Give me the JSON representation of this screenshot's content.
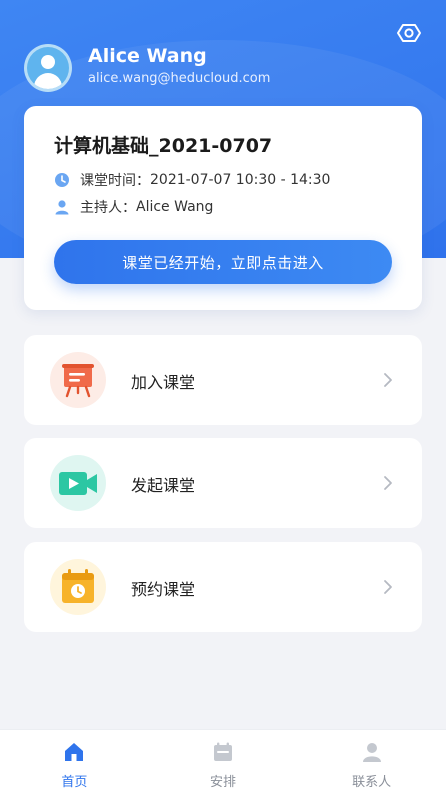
{
  "user": {
    "name": "Alice Wang",
    "email": "alice.wang@heducloud.com"
  },
  "current_class": {
    "title": "计算机基础_2021-0707",
    "time_label": "课堂时间：",
    "time_value": "2021-07-07 10:30 - 14:30",
    "host_label": "主持人：",
    "host_value": "Alice Wang",
    "enter_label": "课堂已经开始，立即点击进入"
  },
  "menu": [
    {
      "label": "加入课堂",
      "icon": "presentation-board-icon"
    },
    {
      "label": "发起课堂",
      "icon": "video-camera-icon"
    },
    {
      "label": "预约课堂",
      "icon": "calendar-clock-icon"
    }
  ],
  "tabs": [
    {
      "label": "首页",
      "icon": "home-icon",
      "active": true
    },
    {
      "label": "安排",
      "icon": "calendar-icon",
      "active": false
    },
    {
      "label": "联系人",
      "icon": "person-icon",
      "active": false
    }
  ],
  "colors": {
    "primary": "#2f74ec",
    "background": "#f2f3f7",
    "tab_inactive": "#8a8f99"
  }
}
